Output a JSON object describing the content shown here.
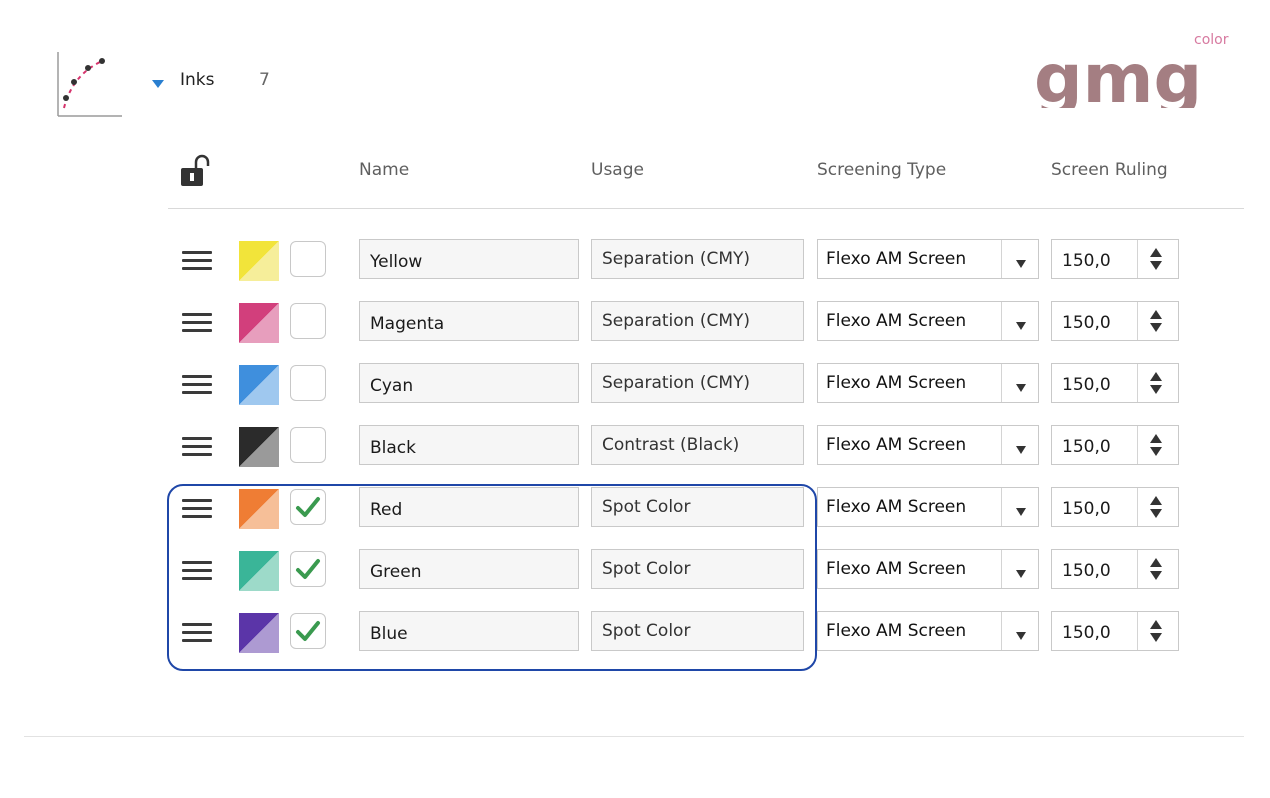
{
  "section": {
    "title": "Inks",
    "count": "7",
    "expanded": true
  },
  "logo": {
    "text": "gmg",
    "superscript": "color",
    "color": "#a47e82"
  },
  "icons": {
    "curve": "tone-curve-icon",
    "toggle": "triangle-down-icon",
    "lock": "unlocked-padlock-icon",
    "handle": "hamburger-icon",
    "check": "checkmark-icon",
    "dropdown": "chevron-down-icon",
    "stepper": "up-down-arrows-icon"
  },
  "columns": {
    "name": "Name",
    "usage": "Usage",
    "screening_type": "Screening Type",
    "screen_ruling": "Screen Ruling"
  },
  "inks": [
    {
      "name": "Yellow",
      "usage": "Separation (CMY)",
      "screening": "Flexo AM Screen",
      "ruling": "150,0",
      "checked": false,
      "color_dark": "#f2e43a",
      "color_light": "#f6ee9a"
    },
    {
      "name": "Magenta",
      "usage": "Separation (CMY)",
      "screening": "Flexo AM Screen",
      "ruling": "150,0",
      "checked": false,
      "color_dark": "#d23f7c",
      "color_light": "#e79ebd"
    },
    {
      "name": "Cyan",
      "usage": "Separation (CMY)",
      "screening": "Flexo AM Screen",
      "ruling": "150,0",
      "checked": false,
      "color_dark": "#3f8fdd",
      "color_light": "#9fc8ef"
    },
    {
      "name": "Black",
      "usage": "Contrast (Black)",
      "screening": "Flexo AM Screen",
      "ruling": "150,0",
      "checked": false,
      "color_dark": "#2b2b2b",
      "color_light": "#9a9a9a"
    },
    {
      "name": "Red",
      "usage": "Spot Color",
      "screening": "Flexo AM Screen",
      "ruling": "150,0",
      "checked": true,
      "color_dark": "#ef7d34",
      "color_light": "#f6bf98"
    },
    {
      "name": "Green",
      "usage": "Spot Color",
      "screening": "Flexo AM Screen",
      "ruling": "150,0",
      "checked": true,
      "color_dark": "#3ab598",
      "color_light": "#9ddac9"
    },
    {
      "name": "Blue",
      "usage": "Spot Color",
      "screening": "Flexo AM Screen",
      "ruling": "150,0",
      "checked": true,
      "color_dark": "#5b35a8",
      "color_light": "#ad9ad2"
    }
  ],
  "colors": {
    "highlight": "#1f47a8",
    "check": "#3a9a4f",
    "toggle": "#2a7fd0"
  }
}
